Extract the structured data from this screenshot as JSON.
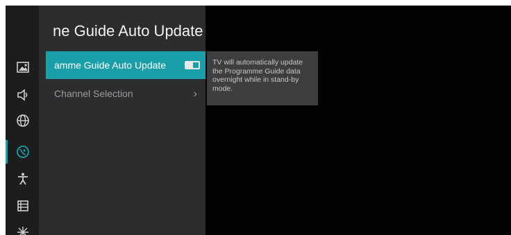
{
  "menu": {
    "title": "ne Guide Auto Update",
    "items": [
      {
        "label": "amme Guide Auto Update",
        "toggle_on": true
      },
      {
        "label": "Channel Selection",
        "chevron": "›"
      }
    ]
  },
  "help_text": "TV will automatically update the Programme Guide data overnight while in stand-by mode.",
  "sidebar": {
    "icons": [
      "picture-icon",
      "sound-icon",
      "network-globe-icon",
      "channels-dish-icon",
      "accessibility-icon",
      "general-settings-icon",
      "more-settings-icon"
    ],
    "selected_index": 3
  },
  "colors": {
    "accent": "#1a9fa8",
    "menu_bg": "#2b2d2f",
    "help_bg": "#3c3e40",
    "screen_bg": "#030303"
  }
}
